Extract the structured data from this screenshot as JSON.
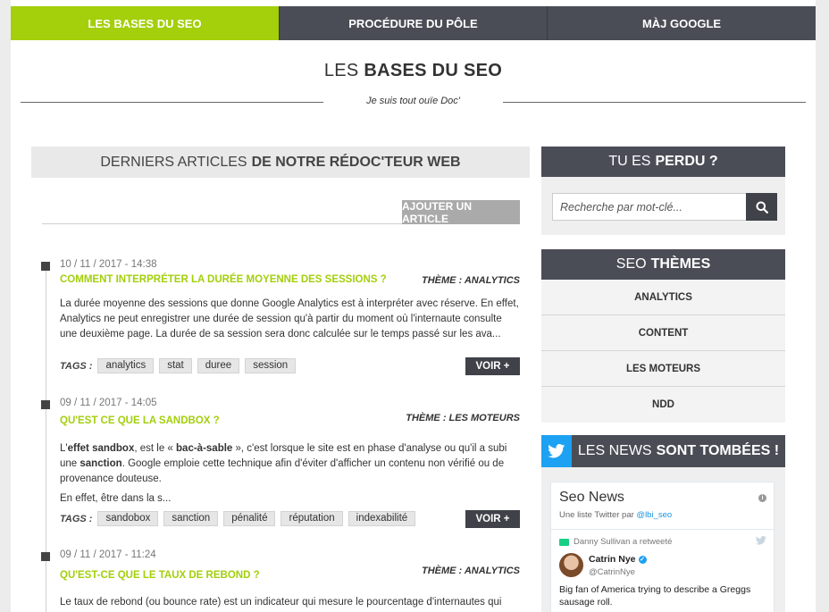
{
  "nav": {
    "items": [
      {
        "label": "LES BASES DU SEO"
      },
      {
        "label": "PROCÉDURE DU PÔLE"
      },
      {
        "label": "MÀJ GOOGLE"
      }
    ]
  },
  "header": {
    "title_light": "LES",
    "title_bold": "BASES DU SEO",
    "tagline": "Je suis tout ouïe Doc'"
  },
  "main": {
    "heading_light": "DERNIERS ARTICLES",
    "heading_bold": "DE NOTRE RÉDOC'TEUR WEB",
    "add_button": "AJOUTER UN ARTICLE",
    "tags_label": "TAGS :",
    "more_label": "VOIR +",
    "articles": [
      {
        "date": "10 / 11 / 2017 - 14:38",
        "title": "COMMENT INTERPRÉTER LA DURÉE MOYENNE DES SESSIONS ?",
        "theme": "THÈME : ANALYTICS",
        "body": "La durée moyenne des sessions que donne Google Analytics est à interpréter avec réserve. En effet, Analytics ne peut enregistrer une durée de session qu'à partir du moment où l'internaute consulte une deuxième page. La durée de sa session sera donc calculée sur le temps passé sur les ava...",
        "tags": [
          "analytics",
          "stat",
          "duree",
          "session"
        ]
      },
      {
        "date": "09 / 11 / 2017 - 14:05",
        "title": "QU'EST CE QUE LA SANDBOX ?",
        "theme": "THÈME : LES MOTEURS",
        "body_html": {
          "p1_a": "L'",
          "p1_b": "effet sandbox",
          "p1_c": ", est le « ",
          "p1_d": "bac-à-sable",
          "p1_e": " », c'est lorsque le site est en phase d'analyse ou qu'il a subi une ",
          "p1_f": "sanction",
          "p1_g": ". Google emploie cette technique afin d'éviter d'afficher un contenu non vérifié ou de provenance douteuse.",
          "p2": "En effet, être dans la s..."
        },
        "tags": [
          "sandobox",
          "sanction",
          "pénalité",
          "réputation",
          "indexabilité"
        ]
      },
      {
        "date": "09 / 11 / 2017 - 11:24",
        "title": "QU'EST-CE QUE LE TAUX DE REBOND ?",
        "theme": "THÈME : ANALYTICS",
        "body": "Le taux de rebond (ou bounce rate) est un indicateur qui mesure le pourcentage d'internautes qui"
      }
    ]
  },
  "sidebar": {
    "lost_light": "TU ES",
    "lost_bold": "PERDU ?",
    "search_placeholder": "Recherche par mot-clé...",
    "themes_light": "SEO",
    "themes_bold": "THÈMES",
    "themes": [
      "ANALYTICS",
      "CONTENT",
      "LES MOTEURS",
      "NDD"
    ],
    "news_light": "LES NEWS",
    "news_bold": "SONT TOMBÉES !",
    "feed": {
      "title": "Seo News",
      "subtitle_prefix": "Une liste Twitter par ",
      "subtitle_handle": "@lbi_seo",
      "retweet_text": "Danny Sullivan a retweeté",
      "user_name": "Catrin Nye",
      "user_handle": "@CatrinNye",
      "tweet": "Big fan of America trying to describe a Greggs sausage roll."
    }
  },
  "colors": {
    "accent": "#a3cf0b",
    "dark": "#4a4d55",
    "twitter": "#1da1f2"
  }
}
